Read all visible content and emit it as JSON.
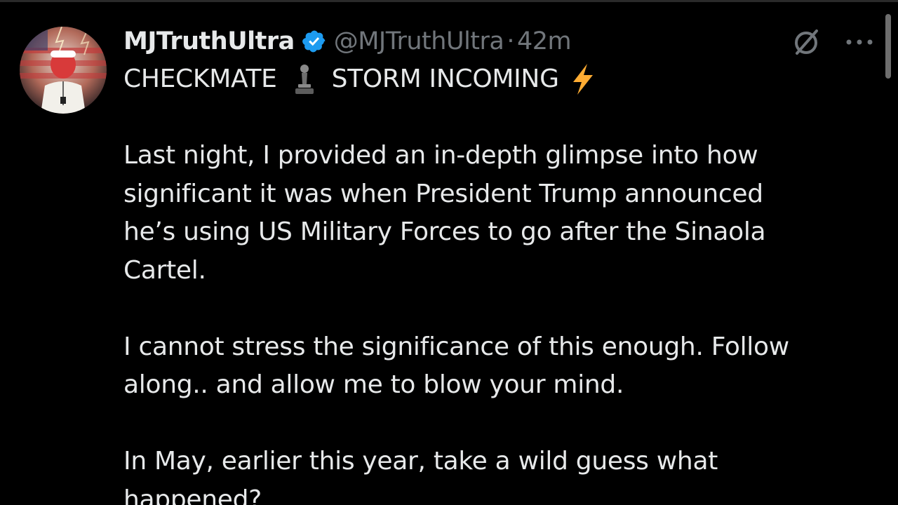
{
  "tweet": {
    "display_name": "MJTruthUltra",
    "handle": "@MJTruthUltra",
    "separator": "·",
    "time": "42m",
    "headline_part1": "CHECKMATE",
    "headline_part2": "STORM INCOMING",
    "paragraph1": [
      "Last night, I provided an in-depth glimpse into how",
      "significant it was when President Trump announced",
      "he’s using US Military Forces to go after the Sinaola",
      "Cartel."
    ],
    "paragraph2": [
      "I cannot stress the significance of this enough. Follow",
      "along.. and allow me to blow your mind."
    ],
    "paragraph3": [
      "In May, earlier this year, take a wild guess what",
      "happened?"
    ]
  },
  "icons": {
    "verified": "verified-badge-icon",
    "grok": "grok-icon",
    "more": "more-options-icon",
    "chess": "chess-pawn-icon",
    "bolt": "lightning-bolt-icon"
  },
  "colors": {
    "background": "#000000",
    "text_primary": "#e7e9ea",
    "text_secondary": "#71767b",
    "verified_blue": "#1d9bf0",
    "bolt_yellow": "#ffac33"
  }
}
